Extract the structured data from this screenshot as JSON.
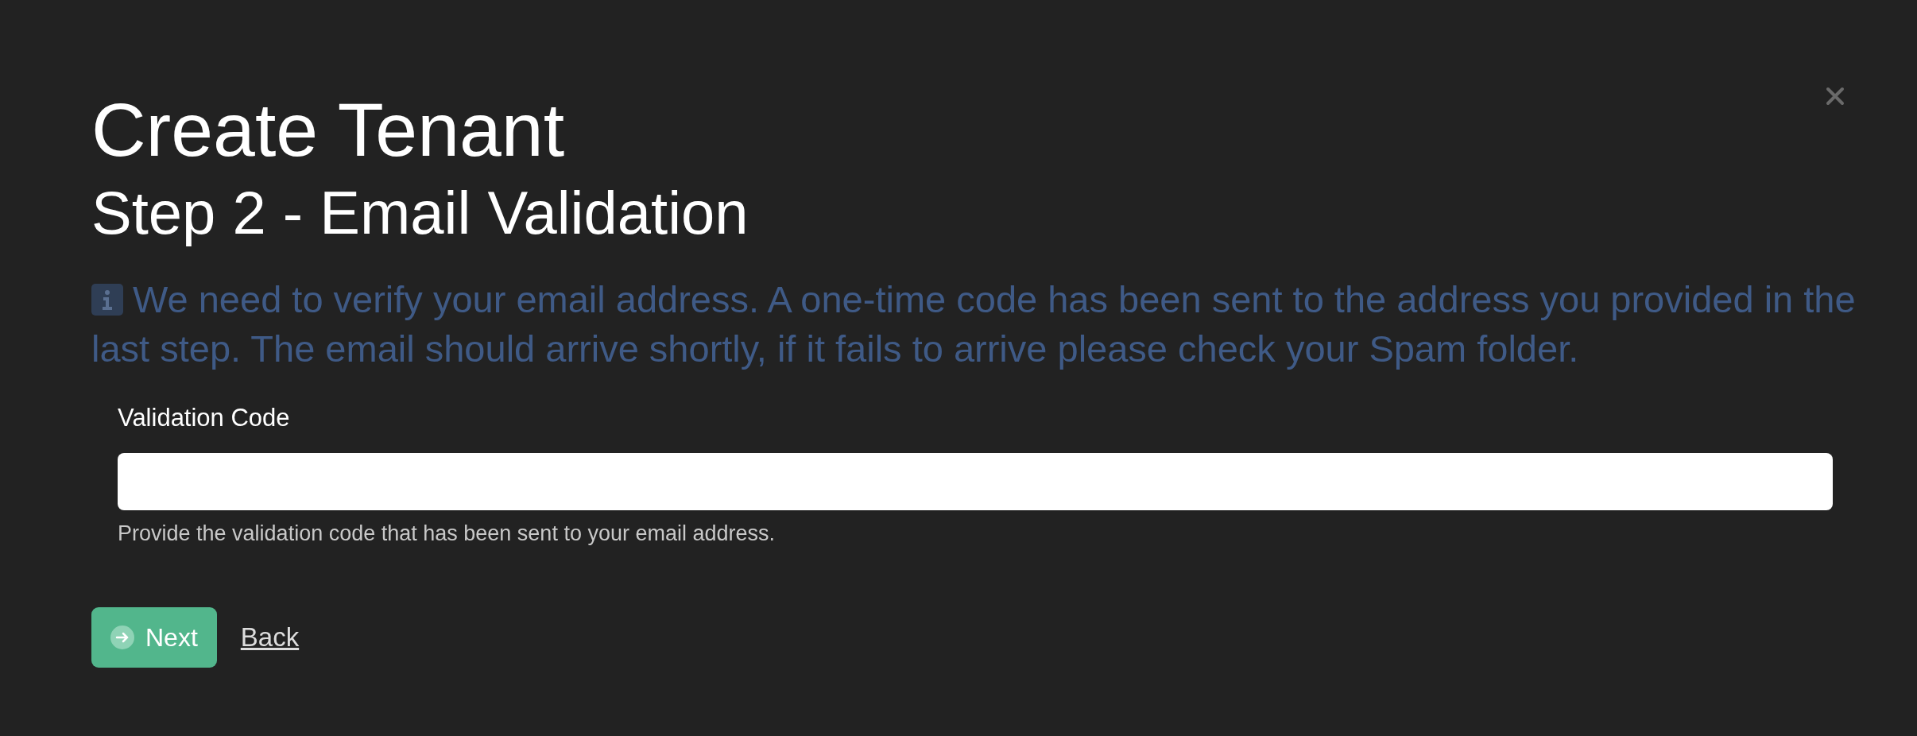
{
  "dialog": {
    "title": "Create Tenant",
    "subtitle": "Step 2 - Email Validation",
    "info": "We need to verify your email address. A one-time code has been sent to the address you provided in the last step. The email should arrive shortly, if it fails to arrive please check your Spam folder.",
    "field": {
      "label": "Validation Code",
      "help": "Provide the validation code that has been sent to your email address."
    },
    "buttons": [
      {
        "kind": "primary",
        "label": "Next"
      },
      {
        "kind": "link",
        "label": "Back"
      }
    ]
  }
}
